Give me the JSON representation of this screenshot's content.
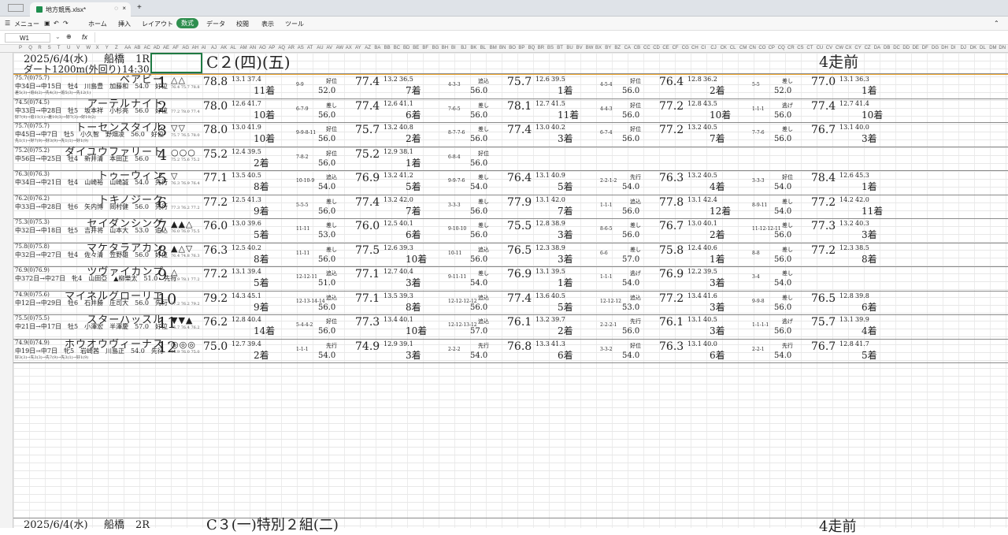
{
  "tab": {
    "title": "地方競馬.xlsx*",
    "close": "×",
    "newtab": "+"
  },
  "menu": {
    "items": [
      "メニュー",
      "ホーム",
      "挿入",
      "レイアウト",
      "数式",
      "データ",
      "校閲",
      "表示",
      "ツール"
    ],
    "active": "数式"
  },
  "formula": {
    "cell": "W1",
    "fx": "fx",
    "value": ""
  },
  "columns": [
    "P",
    "Q",
    "R",
    "S",
    "T",
    "U",
    "V",
    "W",
    "X",
    "Y",
    "Z",
    "AA",
    "AB",
    "AC",
    "AD",
    "AE",
    "AF",
    "AG",
    "AH",
    "AI",
    "AJ",
    "AK",
    "AL",
    "AM",
    "AN",
    "AO",
    "AP",
    "AQ",
    "AR",
    "AS",
    "AT",
    "AU",
    "AV",
    "AW",
    "AX",
    "AY",
    "AZ",
    "BA",
    "BB",
    "BC",
    "BD",
    "BE",
    "BF",
    "BG",
    "BH",
    "BI",
    "BJ",
    "BK",
    "BL",
    "BM",
    "BN",
    "BO",
    "BP",
    "BQ",
    "BR",
    "BS",
    "BT",
    "BU",
    "BV",
    "BW",
    "BX",
    "BY",
    "BZ",
    "CA",
    "CB",
    "CC",
    "CD",
    "CE",
    "CF",
    "CG",
    "CH",
    "CI",
    "CJ",
    "CK",
    "CL",
    "CM",
    "CN",
    "CO",
    "CP",
    "CQ",
    "CR",
    "CS",
    "CT",
    "CU",
    "CV",
    "CW",
    "CX",
    "CY",
    "CZ",
    "DA",
    "DB",
    "DC",
    "DD",
    "DE",
    "DF",
    "DG",
    "DH",
    "DI",
    "DJ",
    "DK",
    "DL",
    "DM",
    "DN"
  ],
  "header": {
    "date": "2025/6/4(水)",
    "venue": "船橋",
    "race": "1R",
    "course": "ダート1200m(外回り)",
    "time": "14:30",
    "class": "C２(四)(五)",
    "past": "4走前"
  },
  "footer": {
    "date": "2025/6/4(水)",
    "venue": "船橋",
    "race": "2R",
    "class": "C３(一)特別２組(二)",
    "past": "4走前"
  },
  "horses": [
    {
      "num": "1",
      "name": "ベアビー",
      "rating": "75.7(0)75.7)",
      "info": "中34日→中15日　牡4　川島豊　加藤和　54.0　好位",
      "sub": "差5(3)→追6(2)→先4(3)→追5(3)→先12(1)",
      "mark": "△△",
      "mini": "76.4 75.7 78.8",
      "past": [
        [
          "78.8",
          "13.1",
          "37.4",
          "11着",
          "9-9",
          "52.0",
          "好位"
        ],
        [
          "77.4",
          "13.2",
          "36.5",
          "7着",
          "4-3-3",
          "56.0",
          "追込"
        ],
        [
          "75.7",
          "12.6",
          "39.5",
          "1着",
          "4-5-4",
          "56.0",
          "好位"
        ],
        [
          "76.4",
          "12.8",
          "36.2",
          "2着",
          "5-5",
          "52.0",
          "差し"
        ],
        [
          "77.0",
          "13.1",
          "36.3",
          "1着",
          "",
          "",
          ""
        ]
      ]
    },
    {
      "num": "2",
      "name": "アーテルナイト",
      "rating": "74.5(0)74.5)",
      "info": "中33日→中28日　牡5　坂本祥　小杉亮　56.0　好位",
      "sub": "好7(9)→追11(1)→差10(3)→好7(3)→好10(2)",
      "mark": "",
      "mini": "77.2 78.0 77.4",
      "past": [
        [
          "78.0",
          "12.6",
          "41.7",
          "10着",
          "6-7-9",
          "56.0",
          "差し"
        ],
        [
          "77.4",
          "12.6",
          "41.1",
          "6着",
          "7-6-5",
          "56.0",
          "差し"
        ],
        [
          "78.1",
          "12.7",
          "41.5",
          "11着",
          "4-4-3",
          "56.0",
          "好位"
        ],
        [
          "77.2",
          "12.8",
          "43.5",
          "10着",
          "1-1-1",
          "56.0",
          "逃げ"
        ],
        [
          "77.4",
          "12.7",
          "41.4",
          "10着",
          "",
          "",
          ""
        ]
      ]
    },
    {
      "num": "3",
      "name": "トーセンスタイル",
      "rating": "75.7(0)75.7)",
      "info": "中45日→中7日　牡5　小久智　野畑凌　56.0　好位",
      "sub": "先1(1)→好7(9)→好3(9)→先1(1)→好1(9)",
      "mark": "▽▽",
      "mini": "75.7 76.5 78.0",
      "past": [
        [
          "78.0",
          "13.0",
          "41.9",
          "10着",
          "9-9-8-11",
          "56.0",
          "好位"
        ],
        [
          "75.7",
          "13.2",
          "40.8",
          "2着",
          "8-7-7-6",
          "56.0",
          "差し"
        ],
        [
          "77.4",
          "13.0",
          "40.2",
          "3着",
          "6-7-4",
          "56.0",
          "好位"
        ],
        [
          "77.2",
          "13.2",
          "40.5",
          "7着",
          "7-7-6",
          "56.0",
          "差し"
        ],
        [
          "76.7",
          "13.1",
          "40.0",
          "3着",
          "",
          "",
          ""
        ]
      ]
    },
    {
      "num": "4",
      "name": "ダイユウファリート",
      "rating": "75.2(0)75.2)",
      "info": "中56日→中25日　牡4　新井清　本田正　56.0",
      "sub": "",
      "mark": "○○○",
      "mini": "75.2 75.6 75.2",
      "past": [
        [
          "75.2",
          "12.4",
          "39.5",
          "2着",
          "7-8-2",
          "56.0",
          "好位"
        ],
        [
          "75.2",
          "12.9",
          "38.1",
          "1着",
          "6-8-4",
          "56.0",
          "好位"
        ],
        [
          "",
          "",
          "",
          "",
          "",
          "",
          ""
        ],
        [
          "",
          "",
          "",
          "",
          "",
          "",
          ""
        ],
        [
          "",
          "",
          "",
          "",
          "",
          "",
          ""
        ]
      ]
    },
    {
      "num": "5",
      "name": "トゥーウィン",
      "rating": "76.3(0)76.3)",
      "info": "中34日→中21日　牡4　山崎裕　山崎誠　54.0　先行",
      "sub": "",
      "mark": "▽",
      "mini": "76.3 76.9 76.4",
      "past": [
        [
          "77.1",
          "13.5",
          "40.5",
          "8着",
          "10-10-9",
          "54.0",
          "追込"
        ],
        [
          "76.9",
          "13.2",
          "41.2",
          "5着",
          "9-9-7-6",
          "54.0",
          "差し"
        ],
        [
          "76.4",
          "13.1",
          "40.9",
          "5着",
          "2-2-1-2",
          "54.0",
          "先行"
        ],
        [
          "76.3",
          "13.2",
          "40.5",
          "4着",
          "3-3-3",
          "54.0",
          "好位"
        ],
        [
          "78.4",
          "12.6",
          "45.3",
          "1着",
          "",
          "",
          ""
        ]
      ]
    },
    {
      "num": "6",
      "name": "トキノジーク",
      "rating": "76.2(0)76.2)",
      "info": "中33日→中28日　牡6　矢内博　岡村健　56.0　先行",
      "sub": "",
      "mark": "",
      "mini": "77.3 76.2 77.2",
      "past": [
        [
          "77.2",
          "12.5",
          "41.3",
          "9着",
          "5-5-5",
          "56.0",
          "差し"
        ],
        [
          "77.4",
          "13.2",
          "42.0",
          "7着",
          "3-3-3",
          "56.0",
          "差し"
        ],
        [
          "77.9",
          "13.1",
          "42.0",
          "7着",
          "1-1-1",
          "56.0",
          "追込"
        ],
        [
          "77.8",
          "13.1",
          "42.4",
          "12着",
          "8-9-11",
          "54.0",
          "差し"
        ],
        [
          "77.2",
          "14.2",
          "42.0",
          "11着",
          "",
          "",
          ""
        ]
      ]
    },
    {
      "num": "7",
      "name": "セイダンシング",
      "rating": "75.3(0)75.3)",
      "info": "中32日→中18日　牡5　吉井将　山本大　53.0　追込",
      "sub": "",
      "mark": "▲▲△",
      "mini": "76.0 76.0 75.5",
      "past": [
        [
          "76.0",
          "13.0",
          "39.6",
          "5着",
          "11-11",
          "53.0",
          "差し"
        ],
        [
          "76.0",
          "12.5",
          "40.1",
          "6着",
          "9-10-10",
          "56.0",
          "差し"
        ],
        [
          "75.5",
          "12.8",
          "38.9",
          "3着",
          "8-6-5",
          "56.0",
          "差し"
        ],
        [
          "76.7",
          "13.0",
          "40.1",
          "2着",
          "11-12-12-11",
          "56.0",
          "差し"
        ],
        [
          "77.3",
          "13.2",
          "40.3",
          "3着",
          "",
          "",
          ""
        ]
      ]
    },
    {
      "num": "8",
      "name": "マケタラアカン",
      "rating": "75.8(0)75.8)",
      "info": "中32日→中27日　牡4　佐々清　笠野雄　56.0　好位",
      "sub": "",
      "mark": "▲△▽",
      "mini": "76.4 74.8 76.3",
      "past": [
        [
          "76.3",
          "12.5",
          "40.2",
          "8着",
          "11-11",
          "56.0",
          "差し"
        ],
        [
          "77.5",
          "12.6",
          "39.3",
          "10着",
          "10-11",
          "56.0",
          "追込"
        ],
        [
          "76.5",
          "12.3",
          "38.9",
          "3着",
          "6-6",
          "57.0",
          "差し"
        ],
        [
          "75.8",
          "12.4",
          "40.6",
          "1着",
          "8-8",
          "56.0",
          "差し"
        ],
        [
          "77.2",
          "12.3",
          "38.5",
          "8着",
          "",
          "",
          ""
        ]
      ]
    },
    {
      "num": "9",
      "name": "ツヴァイカンプ",
      "rating": "76.9(0)76.9)",
      "info": "中372日→中27日　牝4　山田亞　▲柳樂太　51.0　先行",
      "sub": "",
      "mark": "△",
      "mini": "76.9 78.1 77.2",
      "past": [
        [
          "77.2",
          "13.1",
          "39.4",
          "5着",
          "12-12-11",
          "51.0",
          "追込"
        ],
        [
          "77.1",
          "12.7",
          "40.4",
          "3着",
          "9-11-11",
          "54.0",
          "差し"
        ],
        [
          "76.9",
          "13.1",
          "39.5",
          "1着",
          "1-1-1",
          "54.0",
          "逃げ"
        ],
        [
          "76.9",
          "12.2",
          "39.5",
          "3着",
          "3-4",
          "54.0",
          "差し"
        ],
        [
          "",
          "",
          "",
          "",
          "",
          "",
          ""
        ]
      ]
    },
    {
      "num": "10",
      "name": "マイネルグローリエ",
      "rating": "74.9(0)75.6)",
      "info": "中12日→中29日　牡6　石井勝　庄司大　56.0　先行",
      "sub": "",
      "mark": "",
      "mini": "77.2 76.2 79.2",
      "past": [
        [
          "79.2",
          "14.3",
          "45.1",
          "9着",
          "12-13-14-14",
          "56.0",
          "追込"
        ],
        [
          "77.1",
          "13.5",
          "39.3",
          "8着",
          "12-12-12-12",
          "56.0",
          "追込"
        ],
        [
          "77.4",
          "13.6",
          "40.5",
          "5着",
          "12-12-12",
          "53.0",
          "追込"
        ],
        [
          "77.2",
          "13.4",
          "41.6",
          "3着",
          "9-9-8",
          "56.0",
          "差し"
        ],
        [
          "76.5",
          "12.8",
          "39.8",
          "6着",
          "",
          "",
          ""
        ]
      ]
    },
    {
      "num": "11",
      "name": "スターハッスル",
      "rating": "75.5(0)75.5)",
      "info": "中21日→中17日　牡5　小澤宏　半澤慶　57.0　好位",
      "sub": "",
      "mark": "▼▼▲",
      "mini": "75.7 76.4 76.2",
      "past": [
        [
          "76.2",
          "12.8",
          "40.4",
          "14着",
          "5-4-4-2",
          "56.0",
          "好位"
        ],
        [
          "77.3",
          "13.4",
          "40.1",
          "10着",
          "12-12-13-12",
          "57.0",
          "追込"
        ],
        [
          "76.1",
          "13.2",
          "39.7",
          "2着",
          "2-2-2-1",
          "56.0",
          "先行"
        ],
        [
          "76.1",
          "13.1",
          "40.5",
          "3着",
          "1-1-1-1",
          "56.0",
          "逃げ"
        ],
        [
          "75.7",
          "13.1",
          "39.9",
          "4着",
          "",
          "",
          ""
        ]
      ]
    },
    {
      "num": "12",
      "name": "ホウオウヴィーナス",
      "rating": "74.9(0)74.9)",
      "info": "中19日→中7日　牝5　岩崎茜　川島正　54.0　先行",
      "sub": "好3(3)→先3(3)→先7(9)→先3(1)→好1(9)",
      "mark": "◎◎◎",
      "mini": "74.9 76.0 75.0",
      "past": [
        [
          "75.0",
          "12.7",
          "39.4",
          "2着",
          "1-1-1",
          "54.0",
          "先行"
        ],
        [
          "74.9",
          "12.9",
          "39.1",
          "3着",
          "2-2-2",
          "54.0",
          "先行"
        ],
        [
          "76.8",
          "13.3",
          "41.3",
          "6着",
          "3-3-2",
          "54.0",
          "好位"
        ],
        [
          "76.3",
          "13.1",
          "40.0",
          "6着",
          "2-2-1",
          "54.0",
          "先行"
        ],
        [
          "76.7",
          "12.8",
          "41.7",
          "5着",
          "",
          "",
          ""
        ]
      ]
    }
  ]
}
